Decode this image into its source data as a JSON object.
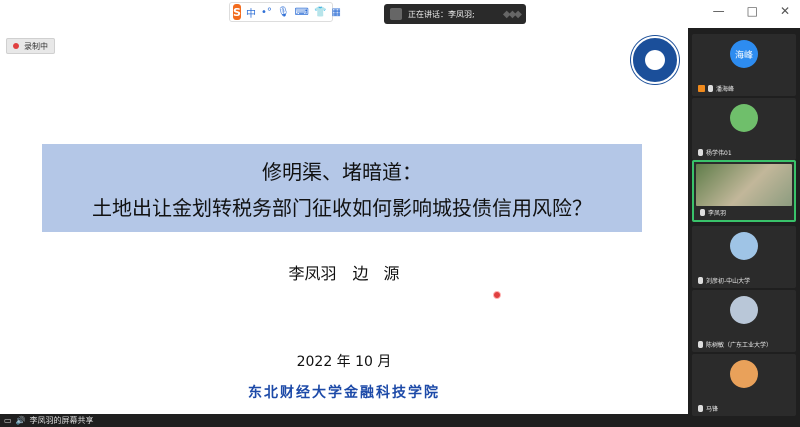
{
  "window": {
    "controls": [
      "—",
      "□",
      "✕"
    ]
  },
  "ime_toolbar": {
    "logo": "S",
    "mode": "中",
    "icons": [
      "punctuation-icon",
      "mic-icon",
      "keyboard-icon",
      "shirt-icon",
      "grid-icon"
    ]
  },
  "speaker": {
    "label": "正在讲话：李凤羽;"
  },
  "recording": {
    "label": "录制中",
    "dot_color": "#e04040"
  },
  "slide": {
    "title_line1": "修明渠、堵暗道：",
    "title_line2": "土地出让金划转税务部门征收如何影响城投债信用风险？",
    "authors": "李凤羽　边 源",
    "date": "2022 年 10 月",
    "school": "东北财经大学金融科技学院",
    "title_bg": "#b4c7e7",
    "school_color": "#1d4aa8"
  },
  "share": {
    "label": "李凤羽的屏幕共享"
  },
  "participants": [
    {
      "name": "潘海峰",
      "avatar_text": "海峰",
      "avatar_color": "#2d8cf0",
      "badge": true
    },
    {
      "name": "杨学伟01",
      "avatar_text": "",
      "avatar_color": "#6fbf6b",
      "badge": false
    },
    {
      "name": "李凤羽",
      "avatar_text": "",
      "avatar_color": "",
      "badge": false,
      "active": true
    },
    {
      "name": "刘彦初-中山大学",
      "avatar_text": "",
      "avatar_color": "#9fc4e6",
      "badge": false
    },
    {
      "name": "陈树敏（广东工业大学）",
      "avatar_text": "",
      "avatar_color": "#b9c7d8",
      "badge": false
    },
    {
      "name": "马锋",
      "avatar_text": "",
      "avatar_color": "#e9a15a",
      "badge": false
    }
  ],
  "accent": "#39c26a"
}
